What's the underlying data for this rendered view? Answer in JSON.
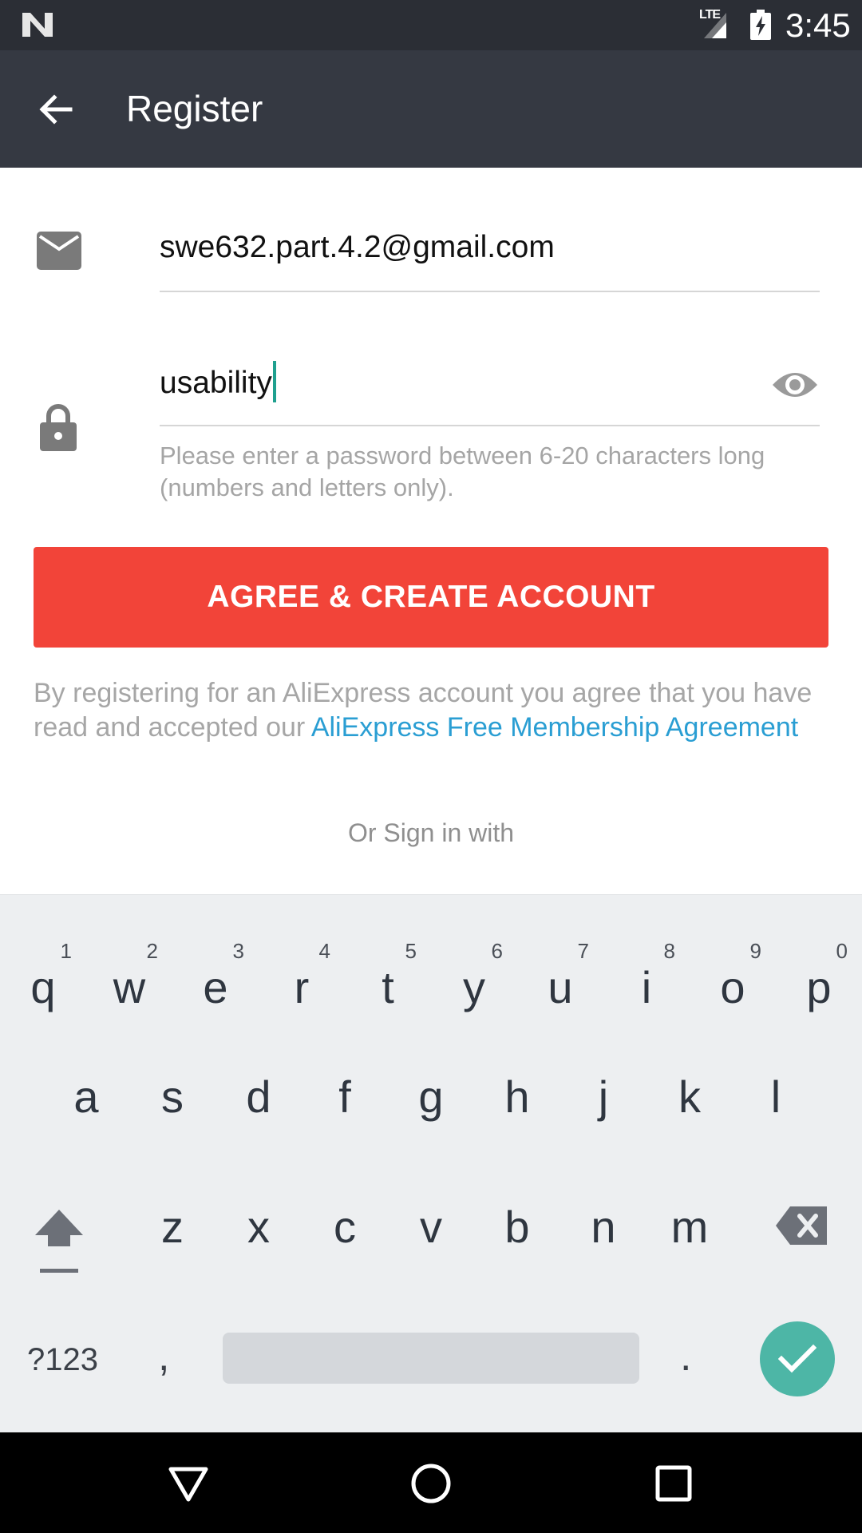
{
  "status_bar": {
    "network": "LTE",
    "time": "3:45"
  },
  "app_bar": {
    "title": "Register"
  },
  "form": {
    "email_value": "swe632.part.4.2@gmail.com",
    "password_value": "usability",
    "password_hint": "Please enter a password between 6-20 characters long (numbers and letters only).",
    "submit_label": "AGREE & CREATE ACCOUNT",
    "terms_prefix": "By registering for an AliExpress account you agree that you have read and accepted our ",
    "terms_link": "AliExpress Free Membership Agreement",
    "or_sign_in": "Or Sign in with"
  },
  "keyboard": {
    "row1": [
      {
        "letter": "q",
        "num": "1"
      },
      {
        "letter": "w",
        "num": "2"
      },
      {
        "letter": "e",
        "num": "3"
      },
      {
        "letter": "r",
        "num": "4"
      },
      {
        "letter": "t",
        "num": "5"
      },
      {
        "letter": "y",
        "num": "6"
      },
      {
        "letter": "u",
        "num": "7"
      },
      {
        "letter": "i",
        "num": "8"
      },
      {
        "letter": "o",
        "num": "9"
      },
      {
        "letter": "p",
        "num": "0"
      }
    ],
    "row2": [
      "a",
      "s",
      "d",
      "f",
      "g",
      "h",
      "j",
      "k",
      "l"
    ],
    "row3": [
      "z",
      "x",
      "c",
      "v",
      "b",
      "n",
      "m"
    ],
    "symbols_label": "?123",
    "comma": ",",
    "period": "."
  },
  "icons": {
    "back": "arrow-back-icon",
    "email": "mail-icon",
    "password": "lock-icon",
    "visibility": "eye-icon",
    "shift": "shift-icon",
    "backspace": "backspace-icon",
    "enter": "check-icon",
    "nav_back": "nav-back-icon",
    "nav_home": "nav-home-icon",
    "nav_recents": "nav-recents-icon"
  },
  "colors": {
    "status_bar": "#2b2e35",
    "app_bar": "#353942",
    "cta": "#f24439",
    "link": "#2a9ed3",
    "cursor": "#1fa08f",
    "enter_key": "#4db6a6"
  }
}
